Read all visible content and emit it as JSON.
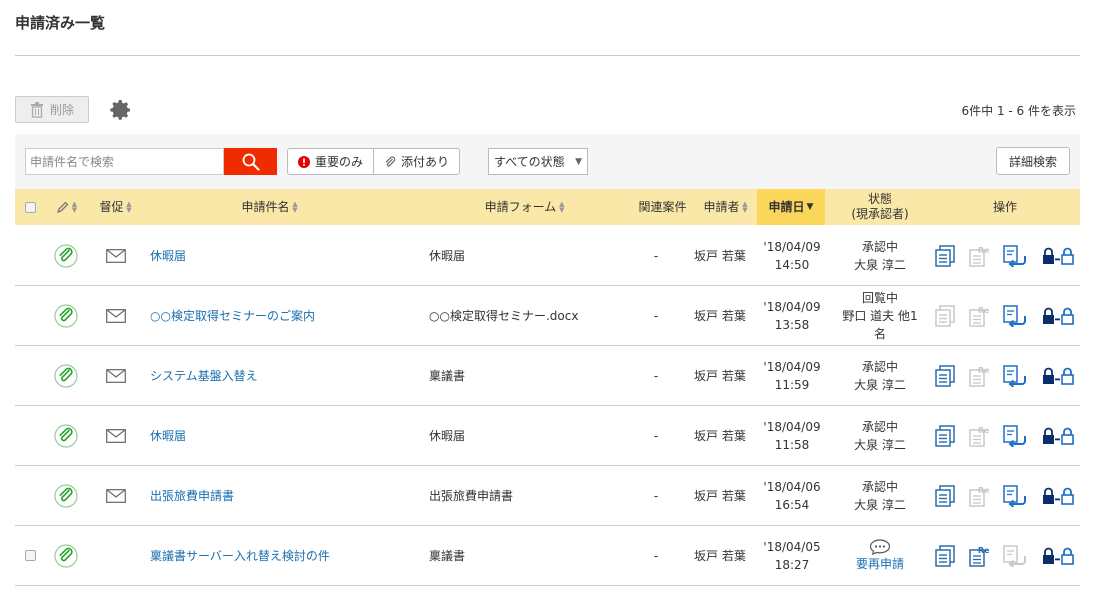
{
  "page": {
    "title": "申請済み一覧"
  },
  "toolbar": {
    "delete_label": "削除",
    "count_text": "6件中 1 - 6 件を表示"
  },
  "filter": {
    "search_placeholder": "申請件名で検索",
    "important_label": "重要のみ",
    "attach_label": "添付あり",
    "status_select": "すべての状態",
    "advanced_label": "詳細検索"
  },
  "table": {
    "headers": {
      "remind": "督促",
      "subject": "申請件名",
      "form": "申請フォーム",
      "related": "関連案件",
      "applicant": "申請者",
      "date": "申請日",
      "status_line1": "状態",
      "status_line2": "(現承認者)",
      "ops": "操作"
    },
    "rows": [
      {
        "subject": "休暇届",
        "form": "休暇届",
        "related": "-",
        "applicant": "坂戸 若葉",
        "date": "'18/04/09",
        "time": "14:50",
        "status1": "承認中",
        "status2": "大泉 淳二"
      },
      {
        "subject": "○○検定取得セミナーのご案内",
        "form": "○○検定取得セミナー.docx",
        "related": "-",
        "applicant": "坂戸 若葉",
        "date": "'18/04/09",
        "time": "13:58",
        "status1": "回覧中",
        "status2": "野口 道夫 他1",
        "status3": "名"
      },
      {
        "subject": "システム基盤入替え",
        "form": "稟議書",
        "related": "-",
        "applicant": "坂戸 若葉",
        "date": "'18/04/09",
        "time": "11:59",
        "status1": "承認中",
        "status2": "大泉 淳二"
      },
      {
        "subject": "休暇届",
        "form": "休暇届",
        "related": "-",
        "applicant": "坂戸 若葉",
        "date": "'18/04/09",
        "time": "11:58",
        "status1": "承認中",
        "status2": "大泉 淳二"
      },
      {
        "subject": "出張旅費申請書",
        "form": "出張旅費申請書",
        "related": "-",
        "applicant": "坂戸 若葉",
        "date": "'18/04/06",
        "time": "16:54",
        "status1": "承認中",
        "status2": "大泉 淳二"
      },
      {
        "subject": "稟議書サーバー入れ替え検討の件",
        "form": "稟議書",
        "related": "-",
        "applicant": "坂戸 若葉",
        "date": "'18/04/05",
        "time": "18:27",
        "status2": "要再申請"
      }
    ]
  },
  "colors": {
    "link": "#1a6fb0",
    "header_bg": "#fae8a8",
    "header_active": "#fad75a",
    "search_btn": "#f02b00"
  }
}
